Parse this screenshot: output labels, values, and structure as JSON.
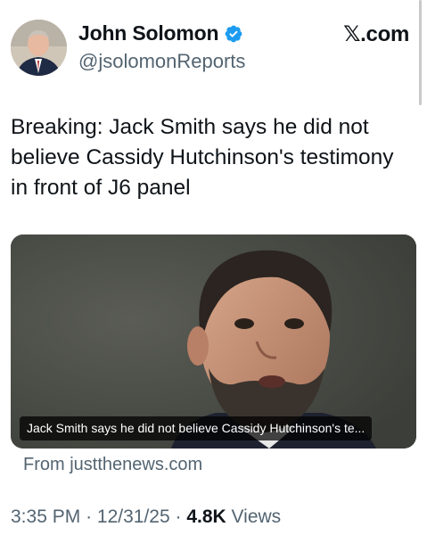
{
  "author": {
    "display_name": "John Solomon",
    "handle": "@jsolomonReports",
    "verified": true,
    "verified_icon": "verified-badge-icon",
    "avatar": "profile-photo"
  },
  "brand": {
    "label": "𝕏.com"
  },
  "tweet": {
    "text": "Breaking: Jack Smith says he did not believe Cassidy Hutchinson's testimony in front of J6 panel"
  },
  "link_card": {
    "caption": "Jack Smith says he did not believe Cassidy Hutchinson's te...",
    "source": "From justthenews.com"
  },
  "meta": {
    "time": "3:35 PM",
    "date": "12/31/25",
    "separator": "·",
    "views_count": "4.8K",
    "views_label": "Views"
  },
  "colors": {
    "text_primary": "#0f1419",
    "text_secondary": "#536471",
    "verified_blue": "#1d9bf0"
  }
}
